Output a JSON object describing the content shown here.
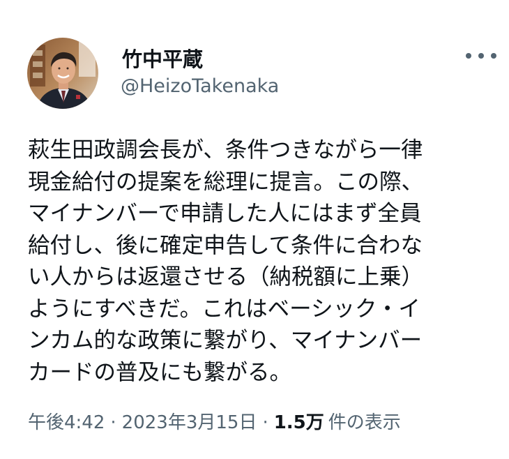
{
  "author": {
    "display_name": "竹中平蔵",
    "handle": "@HeizoTakenaka"
  },
  "tweet": {
    "lines": [
      "萩生田政調会長が、条件つきながら一律",
      "現金給付の提案を総理に提言。この際、",
      "マイナンバーで申請した人にはまず全員",
      "給付し、後に確定申告して条件に合わな",
      "い人からは返還させる（納税額に上乗）",
      "ようにすべきだ。これはベーシック・イ",
      "ンカム的な政策に繋がり、マイナンバー",
      "カードの普及にも繋がる。"
    ]
  },
  "meta": {
    "time": "午後4:42",
    "separator": "·",
    "date": "2023年3月15日",
    "views_count": "1.5万",
    "views_label": "件の表示"
  },
  "icons": {
    "more": "more-horizontal-icon"
  },
  "colors": {
    "text_primary": "#0f1419",
    "text_secondary": "#536471",
    "background": "#ffffff"
  }
}
